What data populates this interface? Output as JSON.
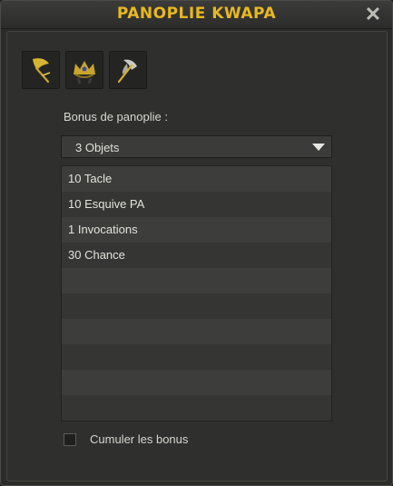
{
  "window": {
    "title": "PANOPLIE KWAPA",
    "close_glyph": "✕"
  },
  "items": [
    {
      "name": "golden-axe-icon"
    },
    {
      "name": "golden-crown-icon"
    },
    {
      "name": "silver-axe-icon"
    }
  ],
  "bonus": {
    "label": "Bonus de panoplie :",
    "selected": "3 Objets"
  },
  "bonus_list": [
    "10 Tacle",
    "10 Esquive PA",
    "1 Invocations",
    "30 Chance",
    "",
    "",
    "",
    "",
    "",
    ""
  ],
  "cumulate": {
    "label": "Cumuler les bonus",
    "checked": false
  },
  "colors": {
    "accent_gold": "#e8b820",
    "background": "#2f2f2d"
  }
}
